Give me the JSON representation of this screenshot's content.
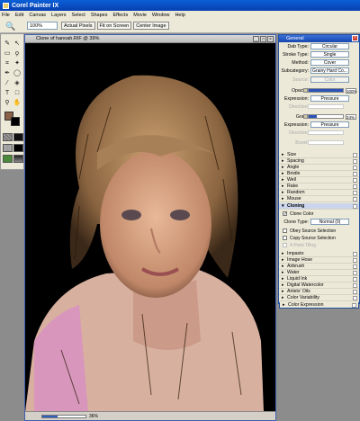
{
  "app": {
    "title": "Corel Painter IX"
  },
  "menu": [
    "File",
    "Edit",
    "Canvas",
    "Layers",
    "Select",
    "Shapes",
    "Effects",
    "Movie",
    "Window",
    "Help"
  ],
  "propbar": {
    "zoom": "100%",
    "actual_pixels": "Actual Pixels",
    "fit_on_screen": "Fit on Screen",
    "center_image": "Center Image"
  },
  "document": {
    "title": "Clone of hannah.RIF @ 39%",
    "zoom_readout": "36%"
  },
  "panel": {
    "title": "General",
    "dab_type_label": "Dab Type:",
    "dab_type": "Circular",
    "stroke_type_label": "Stroke Type:",
    "stroke_type": "Single",
    "method_label": "Method:",
    "method": "Cover",
    "subcategory_label": "Subcategory:",
    "subcategory": "Grainy Hard Co...",
    "source_label": "Source:",
    "source": "Color",
    "opacity_label": "Opacity:",
    "opacity": "100%",
    "opacity_fraction": 1.0,
    "expression1_label": "Expression:",
    "expression1": "Pressure",
    "direction1_label": "Direction:",
    "grain_label": "Grain:",
    "grain": "24%",
    "grain_fraction": 0.24,
    "expression2_label": "Expression:",
    "expression2": "Pressure",
    "direction2_label": "Direction:",
    "boost_label": "Boost:"
  },
  "categories_a": [
    "Size",
    "Spacing",
    "Angle",
    "Bristle",
    "Well",
    "Rake",
    "Random",
    "Mouse"
  ],
  "cloning": {
    "title": "Cloning",
    "clone_color": "Clone Color",
    "clone_type_label": "Clone Type:",
    "clone_type": "Normal (0)",
    "obey_source": "Obey Source Selection",
    "copy_source": "Copy Source Selection",
    "4point": "4-Point Tiling"
  },
  "categories_b": [
    "Impasto",
    "Image Hose",
    "Airbrush",
    "Water",
    "Liquid Ink",
    "Digital Watercolor",
    "Artists' Oils",
    "Color Variability",
    "Color Expression"
  ],
  "icons": [
    "zoom-icon",
    "brush-icon",
    "arrow-icon",
    "rect-select-icon",
    "lasso-icon",
    "crop-icon",
    "magic-wand-icon",
    "pen-icon",
    "shape-icon",
    "dropper-icon",
    "paint-bucket-icon",
    "text-icon",
    "rectangle-icon",
    "magnifier-icon",
    "hand-icon"
  ]
}
